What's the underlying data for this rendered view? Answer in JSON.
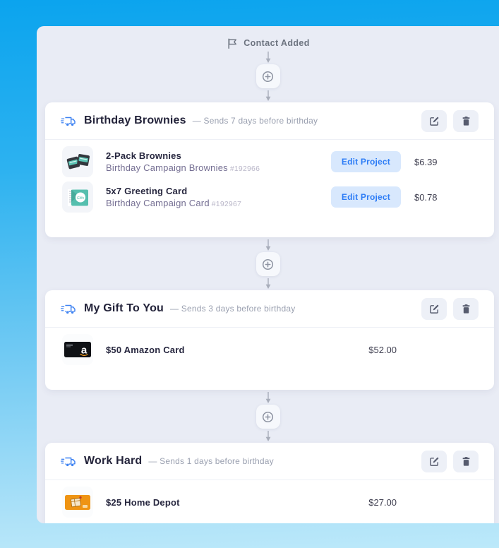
{
  "trigger": {
    "label": "Contact Added"
  },
  "cards": [
    {
      "title": "Birthday Brownies",
      "subtitle": "— Sends 7 days before birthday",
      "products": [
        {
          "name": "2-Pack Brownies",
          "project": "Birthday Campaign Brownies",
          "id": "#192966",
          "action": "Edit Project",
          "price": "$6.39",
          "thumbnail": "brownies-2pack-thumbnail"
        },
        {
          "name": "5x7 Greeting Card",
          "project": "Birthday Campaign Card",
          "id": "#192967",
          "action": "Edit Project",
          "price": "$0.78",
          "thumbnail": "greeting-card-thumbnail"
        }
      ]
    },
    {
      "title": "My Gift To You",
      "subtitle": "— Sends 3 days before birthday",
      "products": [
        {
          "name": "$50 Amazon Card",
          "price": "$52.00",
          "thumbnail": "amazon-gift-card-thumbnail"
        }
      ]
    },
    {
      "title": "Work Hard",
      "subtitle": "— Sends 1 days before birthday",
      "products": [
        {
          "name": "$25 Home Depot",
          "price": "$27.00",
          "thumbnail": "home-depot-gift-card-thumbnail"
        }
      ]
    }
  ],
  "icons": {
    "trigger": "flag-icon",
    "card": "shipping-truck-icon",
    "edit": "pencil-square-icon",
    "delete": "trash-icon",
    "add_step": "circle-plus-icon"
  },
  "colors": {
    "background_top": "#0ba4ee",
    "background_bottom": "#bce9fa",
    "panel": "#e9ecf5",
    "card": "#ffffff",
    "accent_blue": "#3f83f2",
    "edit_project_bg": "#d8e8fd",
    "edit_project_text": "#2c7cf6",
    "title_text": "#23233a",
    "muted_text": "#9aa0b0",
    "connector": "#a8adba"
  }
}
